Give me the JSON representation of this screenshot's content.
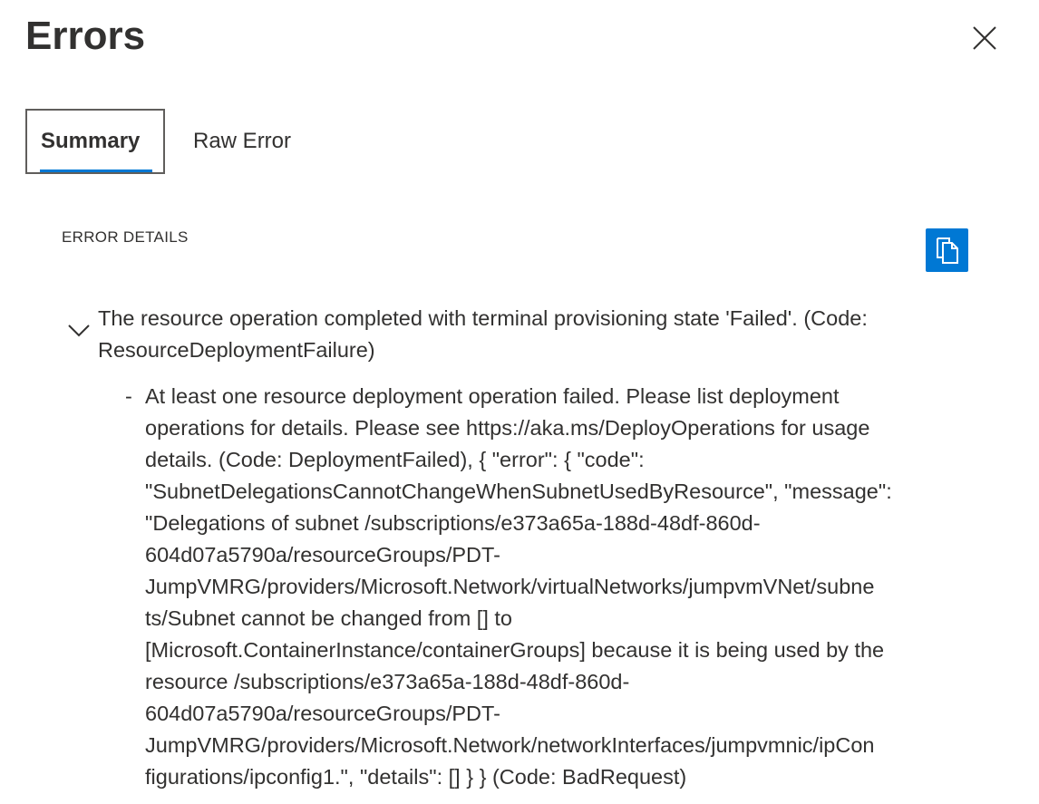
{
  "dialog": {
    "title": "Errors",
    "close_icon": "close-icon"
  },
  "tabs": [
    {
      "label": "Summary",
      "selected": true
    },
    {
      "label": "Raw Error",
      "selected": false
    }
  ],
  "error_details": {
    "label": "ERROR DETAILS",
    "copy_icon": "copy-icon",
    "accent_color": "#0078d4",
    "expand_icon": "chevron-down-icon",
    "message": "The resource operation completed with terminal provisioning state 'Failed'. (Code: ResourceDeploymentFailure)",
    "details": [
      {
        "bullet": "-",
        "lines": [
          "At least one resource deployment operation failed. Please list deployment",
          "operations for details. Please see https://aka.ms/DeployOperations for usage",
          "details. (Code: DeploymentFailed), { \"error\": { \"code\":",
          "\"SubnetDelegationsCannotChangeWhenSubnetUsedByResource\", \"message\":",
          "\"Delegations of subnet /subscriptions/e373a65a-188d-48df-860d-",
          "604d07a5790a/resourceGroups/PDT-",
          "JumpVMRG/providers/Microsoft.Network/virtualNetworks/jumpvmVNet/subne",
          "ts/Subnet cannot be changed from [] to",
          "[Microsoft.ContainerInstance/containerGroups] because it is being used by the",
          "resource /subscriptions/e373a65a-188d-48df-860d-",
          "604d07a5790a/resourceGroups/PDT-",
          "JumpVMRG/providers/Microsoft.Network/networkInterfaces/jumpvmnic/ipCon",
          "figurations/ipconfig1.\", \"details\": [] } } (Code: BadRequest)"
        ]
      }
    ]
  }
}
